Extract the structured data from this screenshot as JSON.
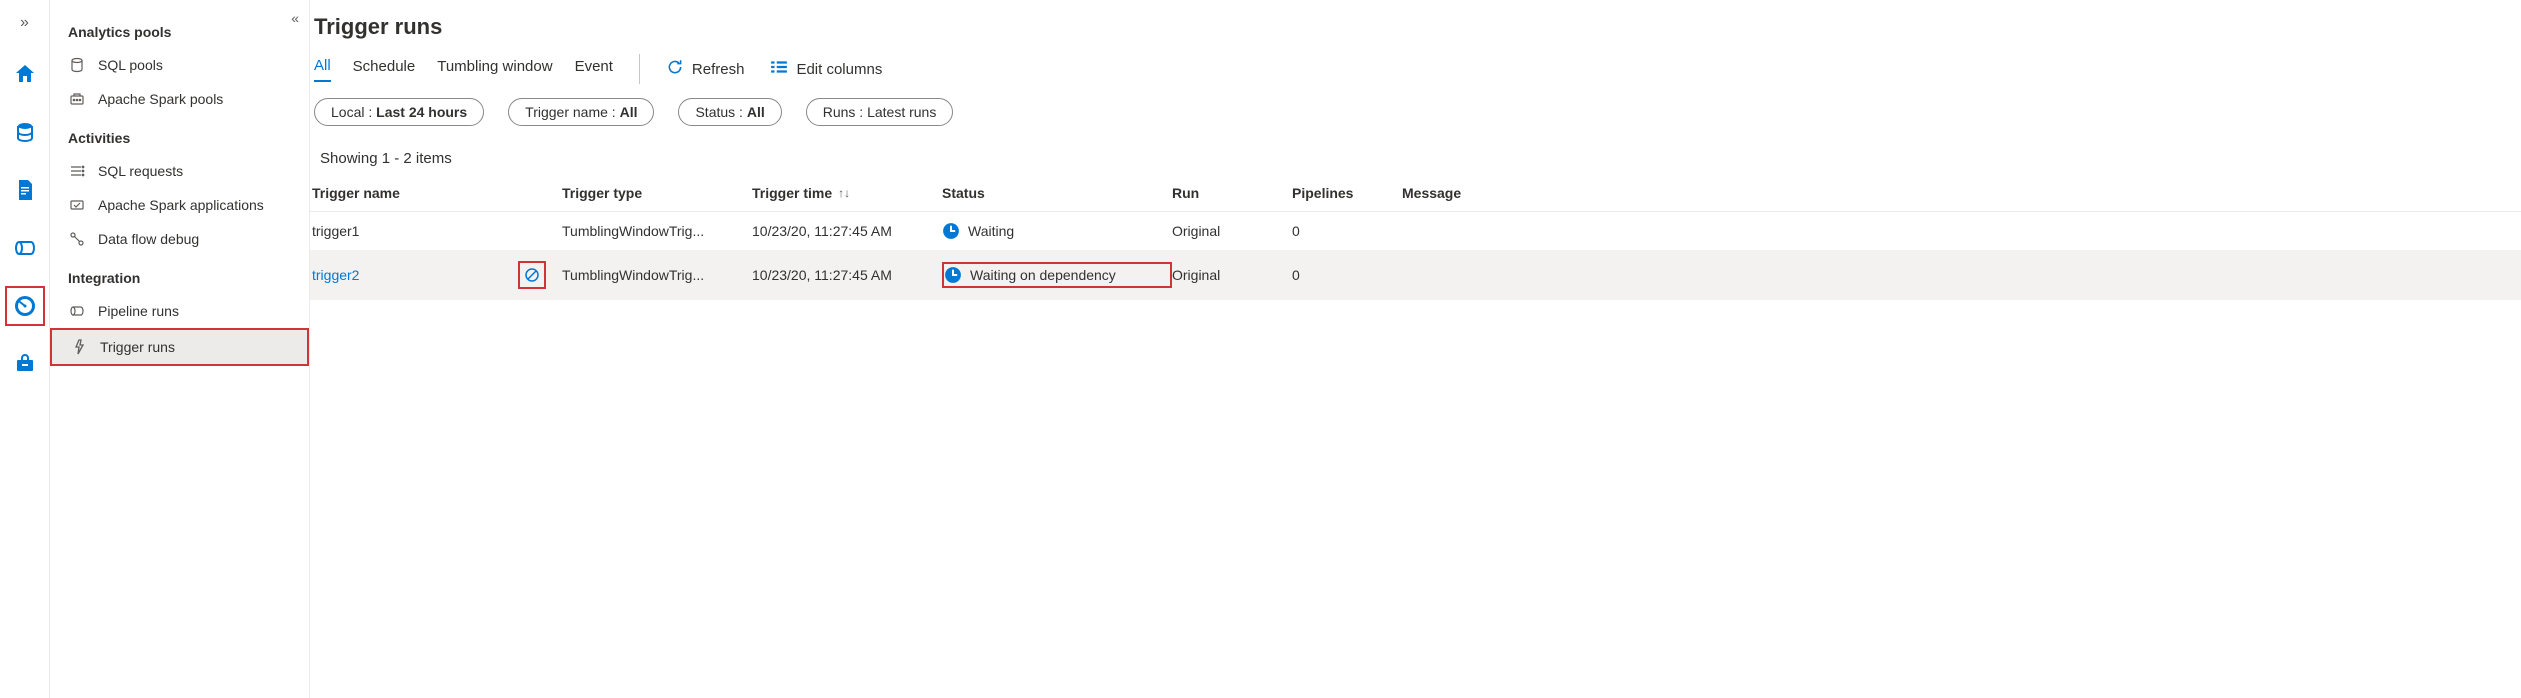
{
  "rail": {
    "expand_glyph": "»",
    "collapse_glyph": "«"
  },
  "nav": {
    "sections": [
      {
        "title": "Analytics pools",
        "items": [
          {
            "key": "sql-pools",
            "label": "SQL pools"
          },
          {
            "key": "spark-pools",
            "label": "Apache Spark pools"
          }
        ]
      },
      {
        "title": "Activities",
        "items": [
          {
            "key": "sql-requests",
            "label": "SQL requests"
          },
          {
            "key": "spark-apps",
            "label": "Apache Spark applications"
          },
          {
            "key": "data-flow-debug",
            "label": "Data flow debug"
          }
        ]
      },
      {
        "title": "Integration",
        "items": [
          {
            "key": "pipeline-runs",
            "label": "Pipeline runs"
          },
          {
            "key": "trigger-runs",
            "label": "Trigger runs"
          }
        ]
      }
    ]
  },
  "page": {
    "title": "Trigger runs",
    "tabs": [
      "All",
      "Schedule",
      "Tumbling window",
      "Event"
    ],
    "active_tab": "All",
    "actions": {
      "refresh": "Refresh",
      "edit_columns": "Edit columns"
    },
    "filters": {
      "local": {
        "label": "Local :",
        "value": "Last 24 hours"
      },
      "trigger_name": {
        "label": "Trigger name :",
        "value": "All"
      },
      "status": {
        "label": "Status :",
        "value": "All"
      },
      "runs": {
        "label": "Runs :",
        "value": "Latest runs"
      }
    },
    "result_text": "Showing 1 - 2 items",
    "columns": {
      "trigger_name": "Trigger name",
      "trigger_type": "Trigger type",
      "trigger_time": "Trigger time",
      "status": "Status",
      "run": "Run",
      "pipelines": "Pipelines",
      "message": "Message"
    },
    "rows": [
      {
        "name": "trigger1",
        "type": "TumblingWindowTrig...",
        "time": "10/23/20, 11:27:45 AM",
        "status": "Waiting",
        "run": "Original",
        "pipelines": "0",
        "message": "",
        "is_link": false,
        "hovered": false,
        "status_highlight": false
      },
      {
        "name": "trigger2",
        "type": "TumblingWindowTrig...",
        "time": "10/23/20, 11:27:45 AM",
        "status": "Waiting on dependency",
        "run": "Original",
        "pipelines": "0",
        "message": "",
        "is_link": true,
        "hovered": true,
        "status_highlight": true
      }
    ]
  },
  "colors": {
    "accent": "#0078d4",
    "highlight": "#d13438"
  }
}
